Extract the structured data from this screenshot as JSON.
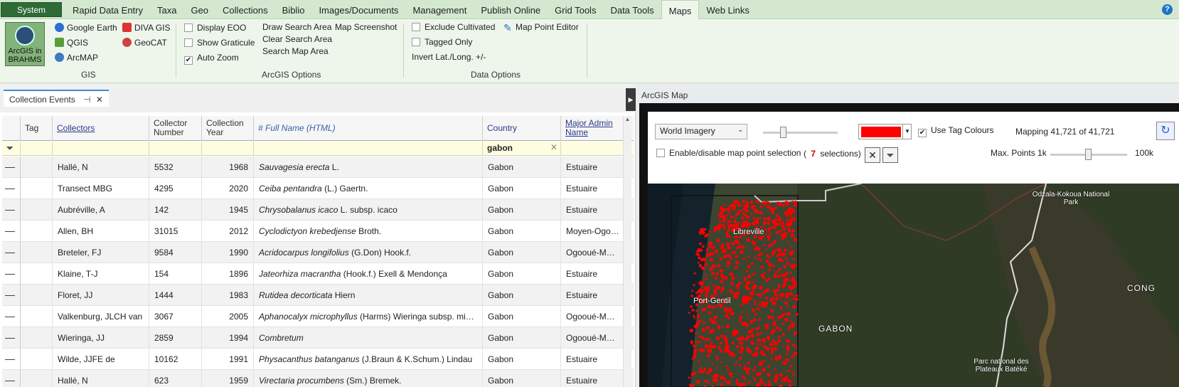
{
  "tabs": {
    "system": "System",
    "items": [
      "Rapid Data Entry",
      "Taxa",
      "Geo",
      "Collections",
      "Biblio",
      "Images/Documents",
      "Management",
      "Publish Online",
      "Grid Tools",
      "Data Tools",
      "Maps",
      "Web Links"
    ],
    "active": "Maps",
    "help": "?"
  },
  "ribbon": {
    "gis": {
      "large_button": "ArcGIS in BRAHMS",
      "google_earth": "Google Earth",
      "diva_gis": "DIVA GIS",
      "qgis": "QGIS",
      "geocat": "GeoCAT",
      "arcmap": "ArcMAP",
      "label": "GIS"
    },
    "arcgis_options": {
      "display_eoo": "Display EOO",
      "show_graticule": "Show Graticule",
      "auto_zoom": "Auto Zoom",
      "draw_search_area": "Draw Search Area",
      "clear_search_area": "Clear Search Area",
      "search_map_area": "Search Map Area",
      "map_screenshot": "Map Screenshot",
      "label": "ArcGIS Options"
    },
    "data_options": {
      "exclude_cultivated": "Exclude Cultivated",
      "tagged_only": "Tagged Only",
      "invert_lat_long": "Invert Lat./Long. +/-",
      "map_point_editor": "Map Point Editor",
      "label": "Data Options"
    }
  },
  "collection_events": {
    "tab_label": "Collection Events",
    "columns": [
      "Tag",
      "Collectors",
      "Collector Number",
      "Collection Year",
      "# Full Name (HTML)",
      "Country",
      "Major Admin Name"
    ],
    "filter": {
      "country": "gabon"
    },
    "rows": [
      {
        "collectors": "Hallé, N",
        "number": "5532",
        "year": "1968",
        "name_italic": "Sauvagesia erecta",
        "name_rest": " L.",
        "country": "Gabon",
        "admin": "Estuaire"
      },
      {
        "collectors": "Transect MBG",
        "number": "4295",
        "year": "2020",
        "name_italic": "Ceiba pentandra",
        "name_rest": " (L.) Gaertn.",
        "country": "Gabon",
        "admin": "Estuaire"
      },
      {
        "collectors": "Aubréville, A",
        "number": "142",
        "year": "1945",
        "name_italic": "Chrysobalanus icaco",
        "name_rest": " L. subsp. icaco",
        "country": "Gabon",
        "admin": "Estuaire"
      },
      {
        "collectors": "Allen, BH",
        "number": "31015",
        "year": "2012",
        "name_italic": "Cyclodictyon krebedjense",
        "name_rest": " Broth.",
        "country": "Gabon",
        "admin": "Moyen-Ogooué"
      },
      {
        "collectors": "Breteler, FJ",
        "number": "9584",
        "year": "1990",
        "name_italic": "Acridocarpus longifolius",
        "name_rest": " (G.Don) Hook.f.",
        "country": "Gabon",
        "admin": "Ogooué-Mariti..."
      },
      {
        "collectors": "Klaine, T-J",
        "number": "154",
        "year": "1896",
        "name_italic": "Jateorhiza macrantha",
        "name_rest": " (Hook.f.) Exell & Mendonça",
        "country": "Gabon",
        "admin": "Estuaire"
      },
      {
        "collectors": "Floret, JJ",
        "number": "1444",
        "year": "1983",
        "name_italic": "Rutidea decorticata",
        "name_rest": " Hiern",
        "country": "Gabon",
        "admin": "Estuaire"
      },
      {
        "collectors": "Valkenburg, JLCH van",
        "number": "3067",
        "year": "2005",
        "name_italic": "Aphanocalyx microphyllus",
        "name_rest": " (Harms) Wieringa subsp. micr...",
        "country": "Gabon",
        "admin": "Ogooué-Mariti..."
      },
      {
        "collectors": "Wieringa, JJ",
        "number": "2859",
        "year": "1994",
        "name_italic": "Combretum",
        "name_rest": "",
        "country": "Gabon",
        "admin": "Ogooué-Mariti..."
      },
      {
        "collectors": "Wilde, JJFE de",
        "number": "10162",
        "year": "1991",
        "name_italic": "Physacanthus batanganus",
        "name_rest": " (J.Braun & K.Schum.) Lindau",
        "country": "Gabon",
        "admin": "Estuaire"
      },
      {
        "collectors": "Hallé, N",
        "number": "623",
        "year": "1959",
        "name_italic": "Virectaria procumbens",
        "name_rest": " (Sm.) Bremek.",
        "country": "Gabon",
        "admin": "Estuaire"
      }
    ]
  },
  "map": {
    "title": "ArcGIS Map",
    "basemap": "World Imagery",
    "use_tag_colours": "Use Tag Colours",
    "mapping_status": "Mapping 41,721 of 41,721",
    "enable_selection": "Enable/disable map point selection",
    "selection_open": "(",
    "selection_count": "7",
    "selection_close": "selections)",
    "max_points_label": "Max. Points 1k",
    "max_points_max": "100k",
    "point_colour": "#ff0000",
    "labels": {
      "libreville": "Libreville",
      "port_gentil": "Port-Gentil",
      "gabon": "GABON",
      "congo": "CONG",
      "odzala": "Odzala-Kokoua National Park",
      "batéké": "Parc national des Plateaux Batéké"
    }
  }
}
